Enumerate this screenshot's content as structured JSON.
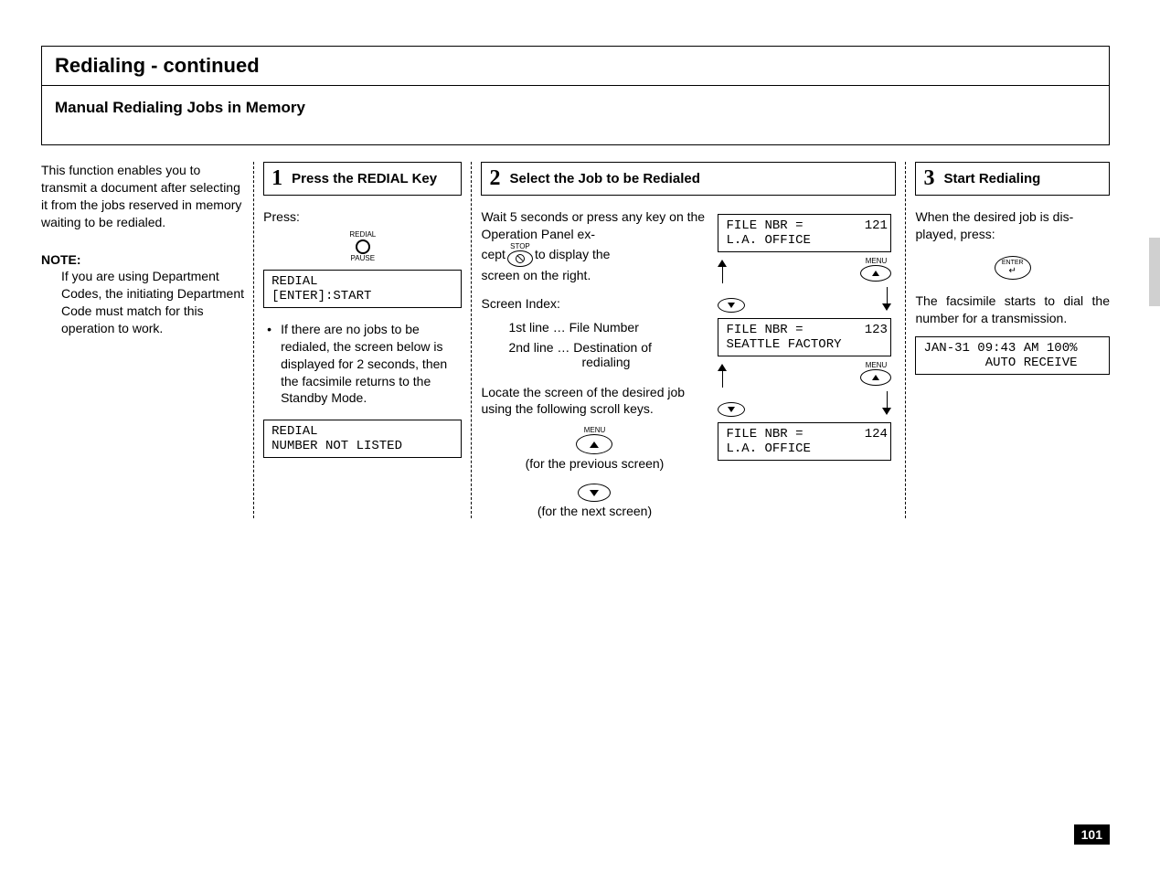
{
  "page_number": "101",
  "header": {
    "title": "Redialing  - continued",
    "subtitle": "Manual Redialing Jobs in Memory"
  },
  "intro": {
    "paragraph": "This function enables you to transmit a document after se­lecting it from the jobs reserved in memory waiting to be redialed.",
    "note_label": "NOTE:",
    "note_body": "If you are using Department Codes, the initiating Depart­ment Code must match for this operation to work."
  },
  "step1": {
    "num": "1",
    "title": "Press the REDIAL Key",
    "press_label": "Press:",
    "redial_top": "REDIAL",
    "redial_bottom": "PAUSE",
    "lcd1_line1": "REDIAL",
    "lcd1_line2": "[ENTER]:START",
    "bullet": "If there are no jobs to be redialed, the screen below is displayed for 2 seconds, then the facsimile returns to the Standby Mode.",
    "lcd2_line1": "REDIAL",
    "lcd2_line2": "NUMBER NOT LISTED"
  },
  "step2": {
    "num": "2",
    "title": "Select the Job to be Redialed",
    "para1a": "Wait 5 seconds or press any key on the Operation Panel ex-",
    "stop_label": "STOP",
    "para1b_a": "cept",
    "para1b_b": "to display the",
    "para1c": "screen on the right.",
    "screen_index_label": "Screen Index:",
    "idx1": "1st line  …  File Number",
    "idx2a": "2nd line  …  Destination of",
    "idx2b": "redialing",
    "para2": "Locate the screen of the de­sired job using the following scroll keys.",
    "menu_label": "MENU",
    "prev_caption": "(for the previous screen)",
    "next_caption": "(for the next screen)",
    "files": [
      {
        "line1": "FILE NBR =        121",
        "line2": "L.A. OFFICE"
      },
      {
        "line1": "FILE NBR =        123",
        "line2": "SEATTLE FACTORY"
      },
      {
        "line1": "FILE NBR =        124",
        "line2": "L.A. OFFICE"
      }
    ]
  },
  "step3": {
    "num": "3",
    "title": "Start Redialing",
    "para1": "When the desired job is dis­played, press:",
    "enter_label": "ENTER",
    "para2": "The facsimile starts to dial the number for a transmission.",
    "lcd_line1": "JAN-31 09:43 AM 100%",
    "lcd_line2": "        AUTO RECEIVE"
  }
}
